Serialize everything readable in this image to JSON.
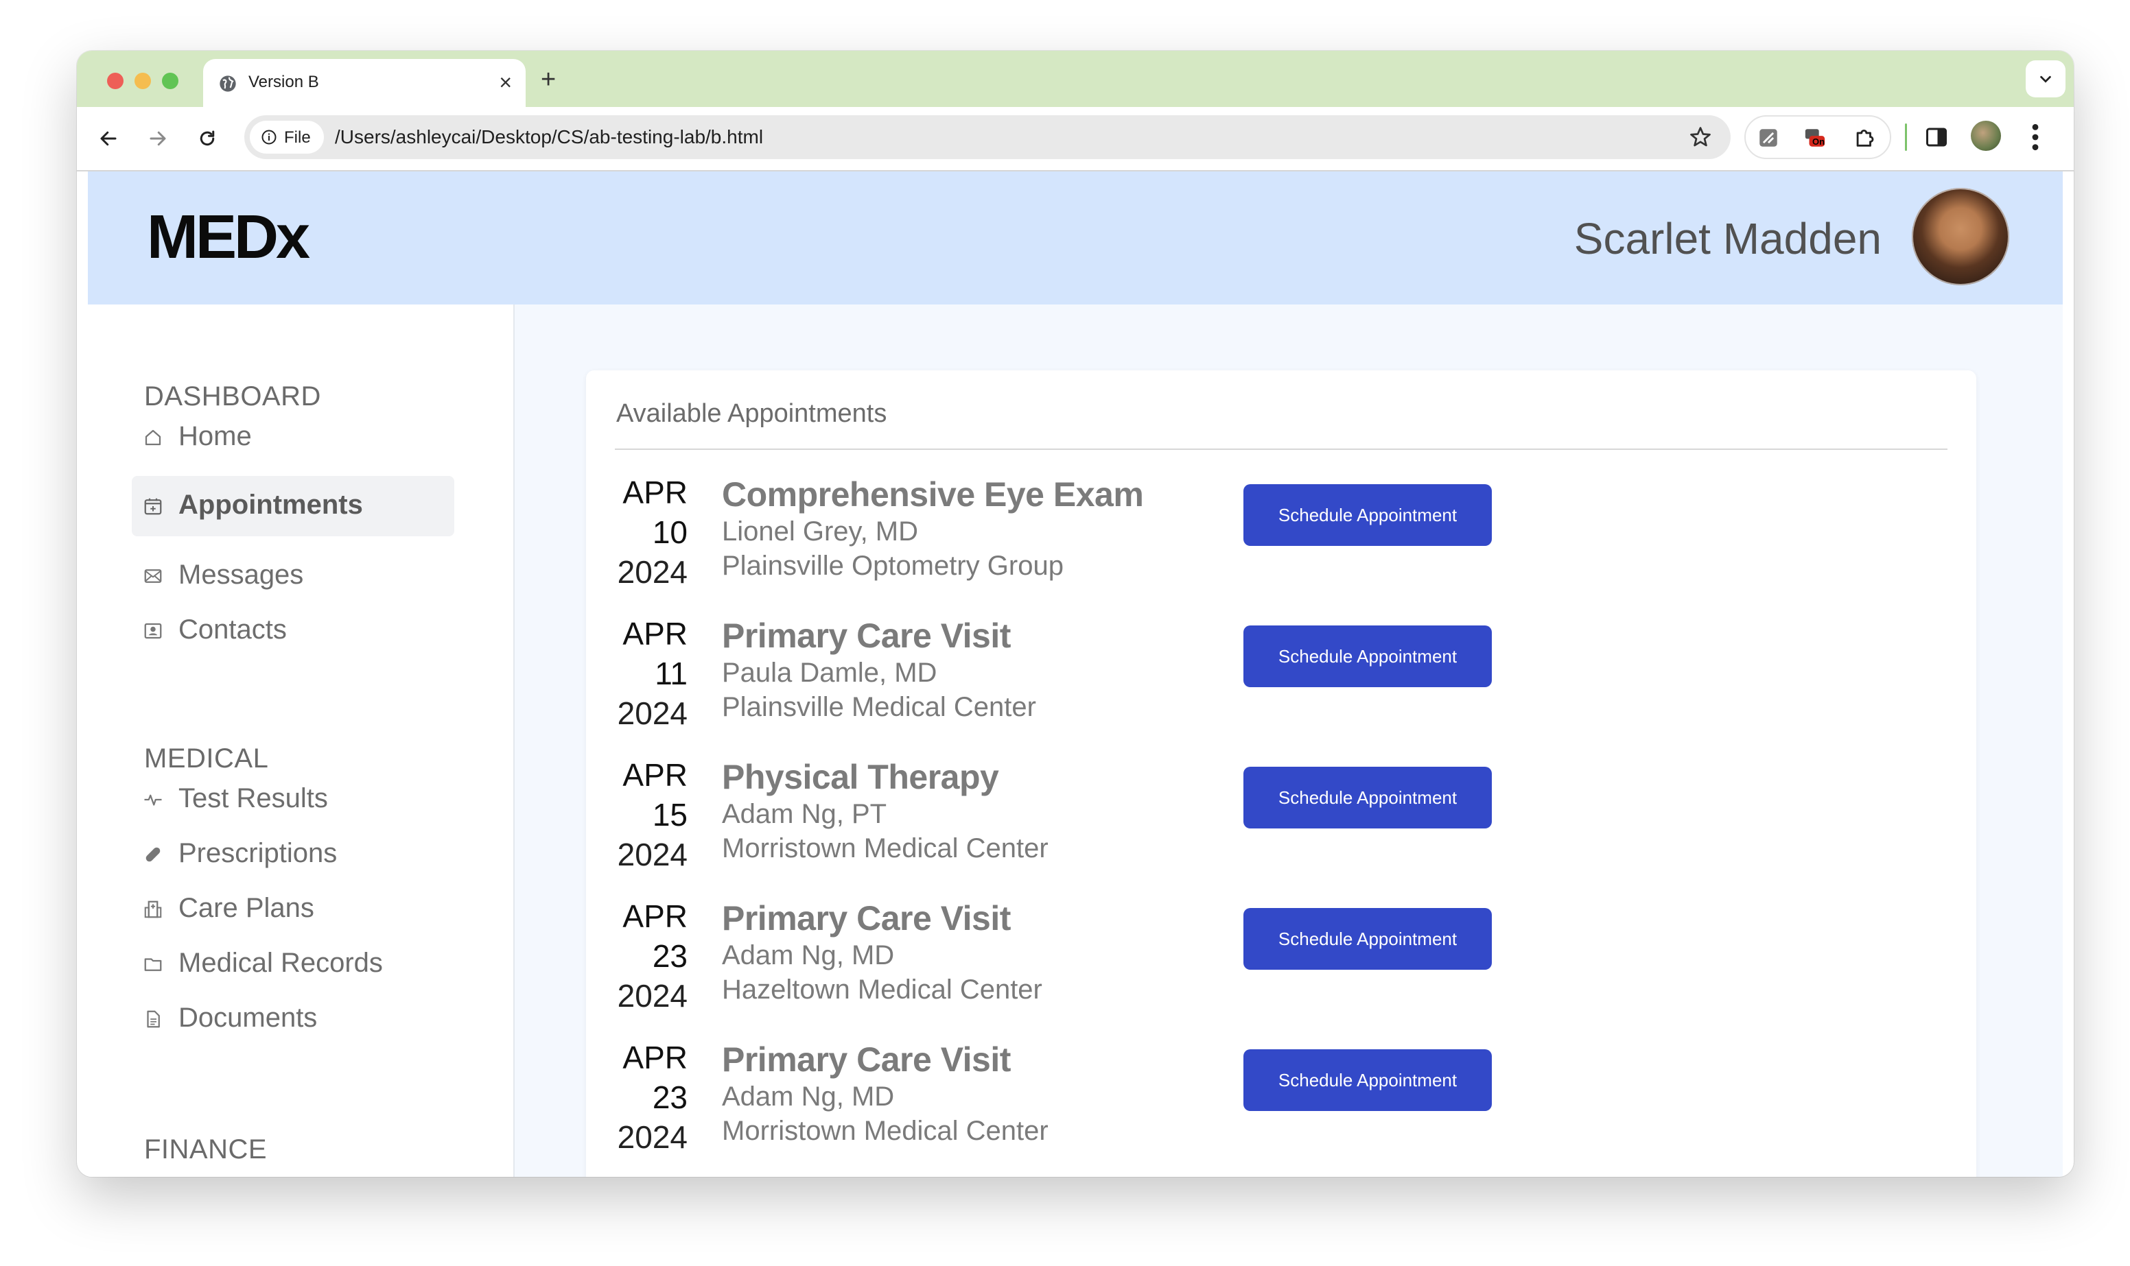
{
  "browser": {
    "tab_title": "Version B",
    "new_tab_symbol": "+",
    "close_symbol": "×",
    "chip_label": "File",
    "url": "/Users/ashleycai/Desktop/CS/ab-testing-lab/b.html",
    "extension_badge": "On",
    "icons": [
      "globe-icon",
      "close-icon",
      "new-tab-icon",
      "tab-search-icon",
      "back-icon",
      "forward-icon",
      "reload-icon",
      "info-icon",
      "star-icon",
      "extension-icon",
      "puzzle-icon",
      "side-panel-icon",
      "profile-icon",
      "more-icon"
    ]
  },
  "header": {
    "logo": "MEDx",
    "user_name": "Scarlet Madden"
  },
  "sidebar": {
    "sections": [
      {
        "title": "DASHBOARD",
        "items": [
          {
            "label": "Home",
            "icon": "home-icon"
          },
          {
            "label": "Appointments",
            "icon": "calendar-icon",
            "active": true
          },
          {
            "label": "Messages",
            "icon": "mail-icon"
          },
          {
            "label": "Contacts",
            "icon": "contact-card-icon"
          }
        ]
      },
      {
        "title": "MEDICAL",
        "items": [
          {
            "label": "Test Results",
            "icon": "pulse-icon"
          },
          {
            "label": "Prescriptions",
            "icon": "pill-icon"
          },
          {
            "label": "Care Plans",
            "icon": "hospital-icon"
          },
          {
            "label": "Medical Records",
            "icon": "folder-icon"
          },
          {
            "label": "Documents",
            "icon": "document-icon"
          }
        ]
      },
      {
        "title": "FINANCE",
        "items": []
      }
    ]
  },
  "main": {
    "card_title": "Available Appointments",
    "appointments": [
      {
        "month": "APR",
        "day": "10",
        "year": "2024",
        "title": "Comprehensive Eye Exam",
        "doctor": "Lionel Grey, MD",
        "location": "Plainsville Optometry Group",
        "button": "Schedule Appointment"
      },
      {
        "month": "APR",
        "day": "11",
        "year": "2024",
        "title": "Primary Care Visit",
        "doctor": "Paula Damle, MD",
        "location": "Plainsville Medical Center",
        "button": "Schedule Appointment"
      },
      {
        "month": "APR",
        "day": "15",
        "year": "2024",
        "title": "Physical Therapy",
        "doctor": "Adam Ng, PT",
        "location": "Morristown Medical Center",
        "button": "Schedule Appointment"
      },
      {
        "month": "APR",
        "day": "23",
        "year": "2024",
        "title": "Primary Care Visit",
        "doctor": "Adam Ng, MD",
        "location": "Hazeltown Medical Center",
        "button": "Schedule Appointment"
      },
      {
        "month": "APR",
        "day": "23",
        "year": "2024",
        "title": "Primary Care Visit",
        "doctor": "Adam Ng, MD",
        "location": "Morristown Medical Center",
        "button": "Schedule Appointment"
      }
    ]
  },
  "colors": {
    "tab_strip": "#d5e8c3",
    "header_bg": "#d4e5fd",
    "page_bg": "#f4f8fe",
    "button_bg": "#3349c8",
    "button_text": "#ffffff"
  }
}
